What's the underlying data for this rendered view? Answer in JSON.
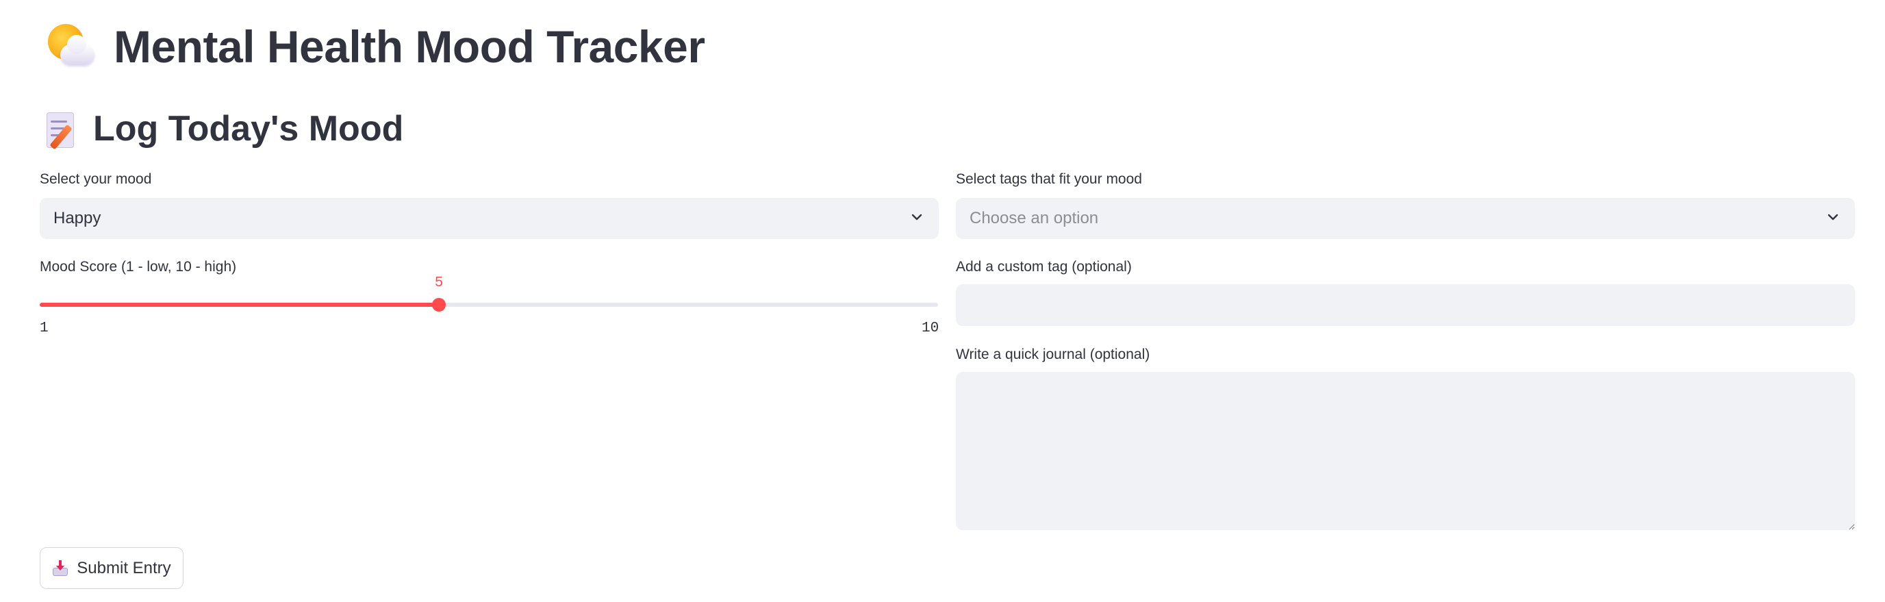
{
  "header": {
    "title": "Mental Health Mood Tracker",
    "title_icon": "sun-behind-cloud-icon"
  },
  "section": {
    "title": "Log Today's Mood",
    "icon": "memo-icon"
  },
  "mood_select": {
    "label": "Select your mood",
    "value": "Happy"
  },
  "mood_score": {
    "label": "Mood Score (1 - low, 10 - high)",
    "value": 5,
    "min": 1,
    "max": 10,
    "min_label": "1",
    "max_label": "10",
    "value_label": "5",
    "accent_color": "#ff4b4b"
  },
  "tags_select": {
    "label": "Select tags that fit your mood",
    "placeholder": "Choose an option"
  },
  "custom_tag": {
    "label": "Add a custom tag (optional)",
    "value": "",
    "placeholder": ""
  },
  "journal": {
    "label": "Write a quick journal (optional)",
    "value": "",
    "placeholder": ""
  },
  "submit": {
    "label": "Submit Entry",
    "icon": "inbox-tray-icon"
  }
}
